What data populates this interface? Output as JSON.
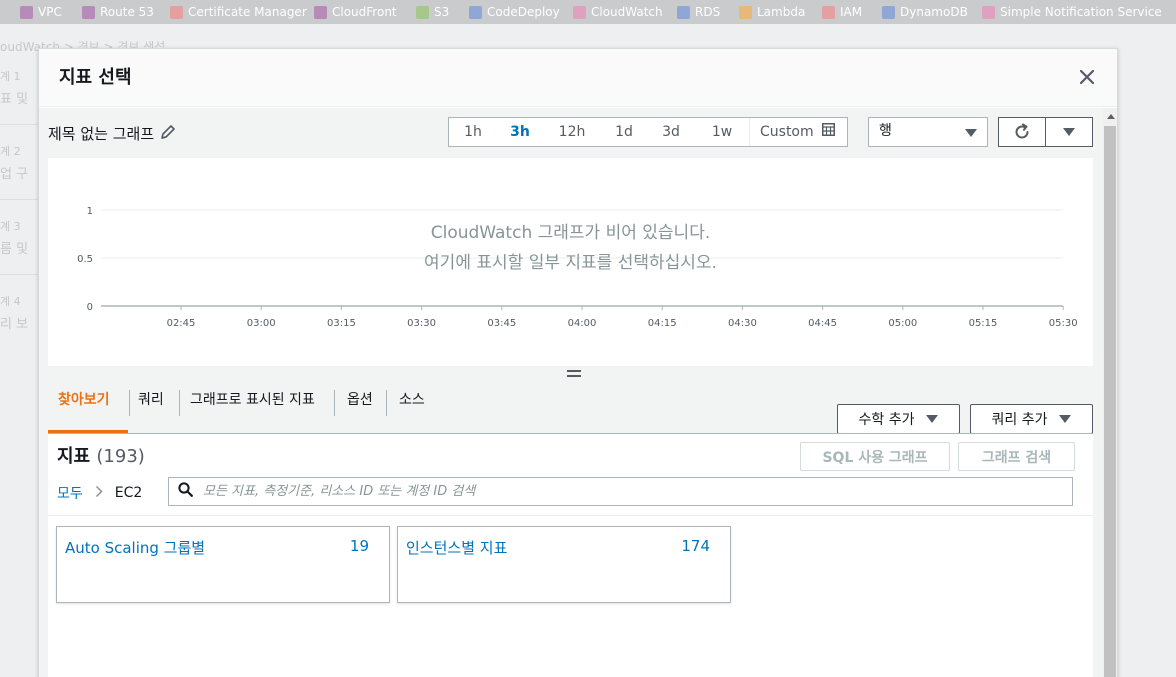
{
  "service_bar": {
    "items": [
      {
        "label": "VPC",
        "color": "#b68ab9"
      },
      {
        "label": "Route 53",
        "color": "#b68ab9"
      },
      {
        "label": "Certificate Manager",
        "color": "#e4a0a0"
      },
      {
        "label": "CloudFront",
        "color": "#b68ab9"
      },
      {
        "label": "S3",
        "color": "#a6c88a"
      },
      {
        "label": "CodeDeploy",
        "color": "#8fa6d6"
      },
      {
        "label": "CloudWatch",
        "color": "#e0a0c0"
      },
      {
        "label": "RDS",
        "color": "#8fa6d6"
      },
      {
        "label": "Lambda",
        "color": "#e8b87a"
      },
      {
        "label": "IAM",
        "color": "#e4a0a0"
      },
      {
        "label": "DynamoDB",
        "color": "#8fa6d6"
      },
      {
        "label": "Simple Notification Service",
        "color": "#e0a0c0"
      }
    ]
  },
  "background_page": {
    "breadcrumb": "oudWatch  >  경보  >  경보 생성",
    "steps": [
      {
        "num": "계 1",
        "label": "표 및"
      },
      {
        "num": "계 2",
        "label": "업 구"
      },
      {
        "num": "계 3",
        "label": "름 및"
      },
      {
        "num": "계 4",
        "label": "리 보"
      }
    ]
  },
  "modal": {
    "title": "지표 선택",
    "graph_title": "제목 없는 그래프",
    "time_ranges": [
      {
        "label": "1h",
        "active": false
      },
      {
        "label": "3h",
        "active": true
      },
      {
        "label": "12h",
        "active": false
      },
      {
        "label": "1d",
        "active": false
      },
      {
        "label": "3d",
        "active": false
      },
      {
        "label": "1w",
        "active": false
      }
    ],
    "custom_label": "Custom",
    "view_select": "행",
    "empty_line1": "CloudWatch 그래프가 비어 있습니다.",
    "empty_line2": "여기에 표시할 일부 지표를 선택하십시오.",
    "tabs": [
      {
        "label": "찾아보기",
        "active": true
      },
      {
        "label": "쿼리",
        "active": false
      },
      {
        "label": "그래프로 표시된 지표",
        "active": false
      },
      {
        "label": "옵션",
        "active": false
      },
      {
        "label": "소스",
        "active": false
      }
    ],
    "add_math_label": "수학 추가",
    "add_query_label": "쿼리 추가",
    "metrics_title": "지표",
    "metrics_count": "(193)",
    "sql_graph_label": "SQL 사용 그래프",
    "graph_search_label": "그래프 검색",
    "breadcrumb_all": "모두",
    "breadcrumb_current": "EC2",
    "search_placeholder": "모든 지표, 측정기준, 리소스 ID 또는 계정 ID 검색",
    "cards": [
      {
        "label": "Auto Scaling 그룹별",
        "count": "19"
      },
      {
        "label": "인스턴스별 지표",
        "count": "174"
      }
    ]
  },
  "chart_data": {
    "type": "line",
    "title": "",
    "xlabel": "",
    "ylabel": "",
    "categories": [
      "02:45",
      "03:00",
      "03:15",
      "03:30",
      "03:45",
      "04:00",
      "04:15",
      "04:30",
      "04:45",
      "05:00",
      "05:15",
      "05:30"
    ],
    "y_ticks": [
      "1",
      "0.5",
      "0"
    ],
    "ylim": [
      0,
      1
    ],
    "series": [],
    "grid": true,
    "colors": {
      "grid": "#eaeded",
      "axis": "#aab7b8",
      "text": "#545b64"
    }
  }
}
